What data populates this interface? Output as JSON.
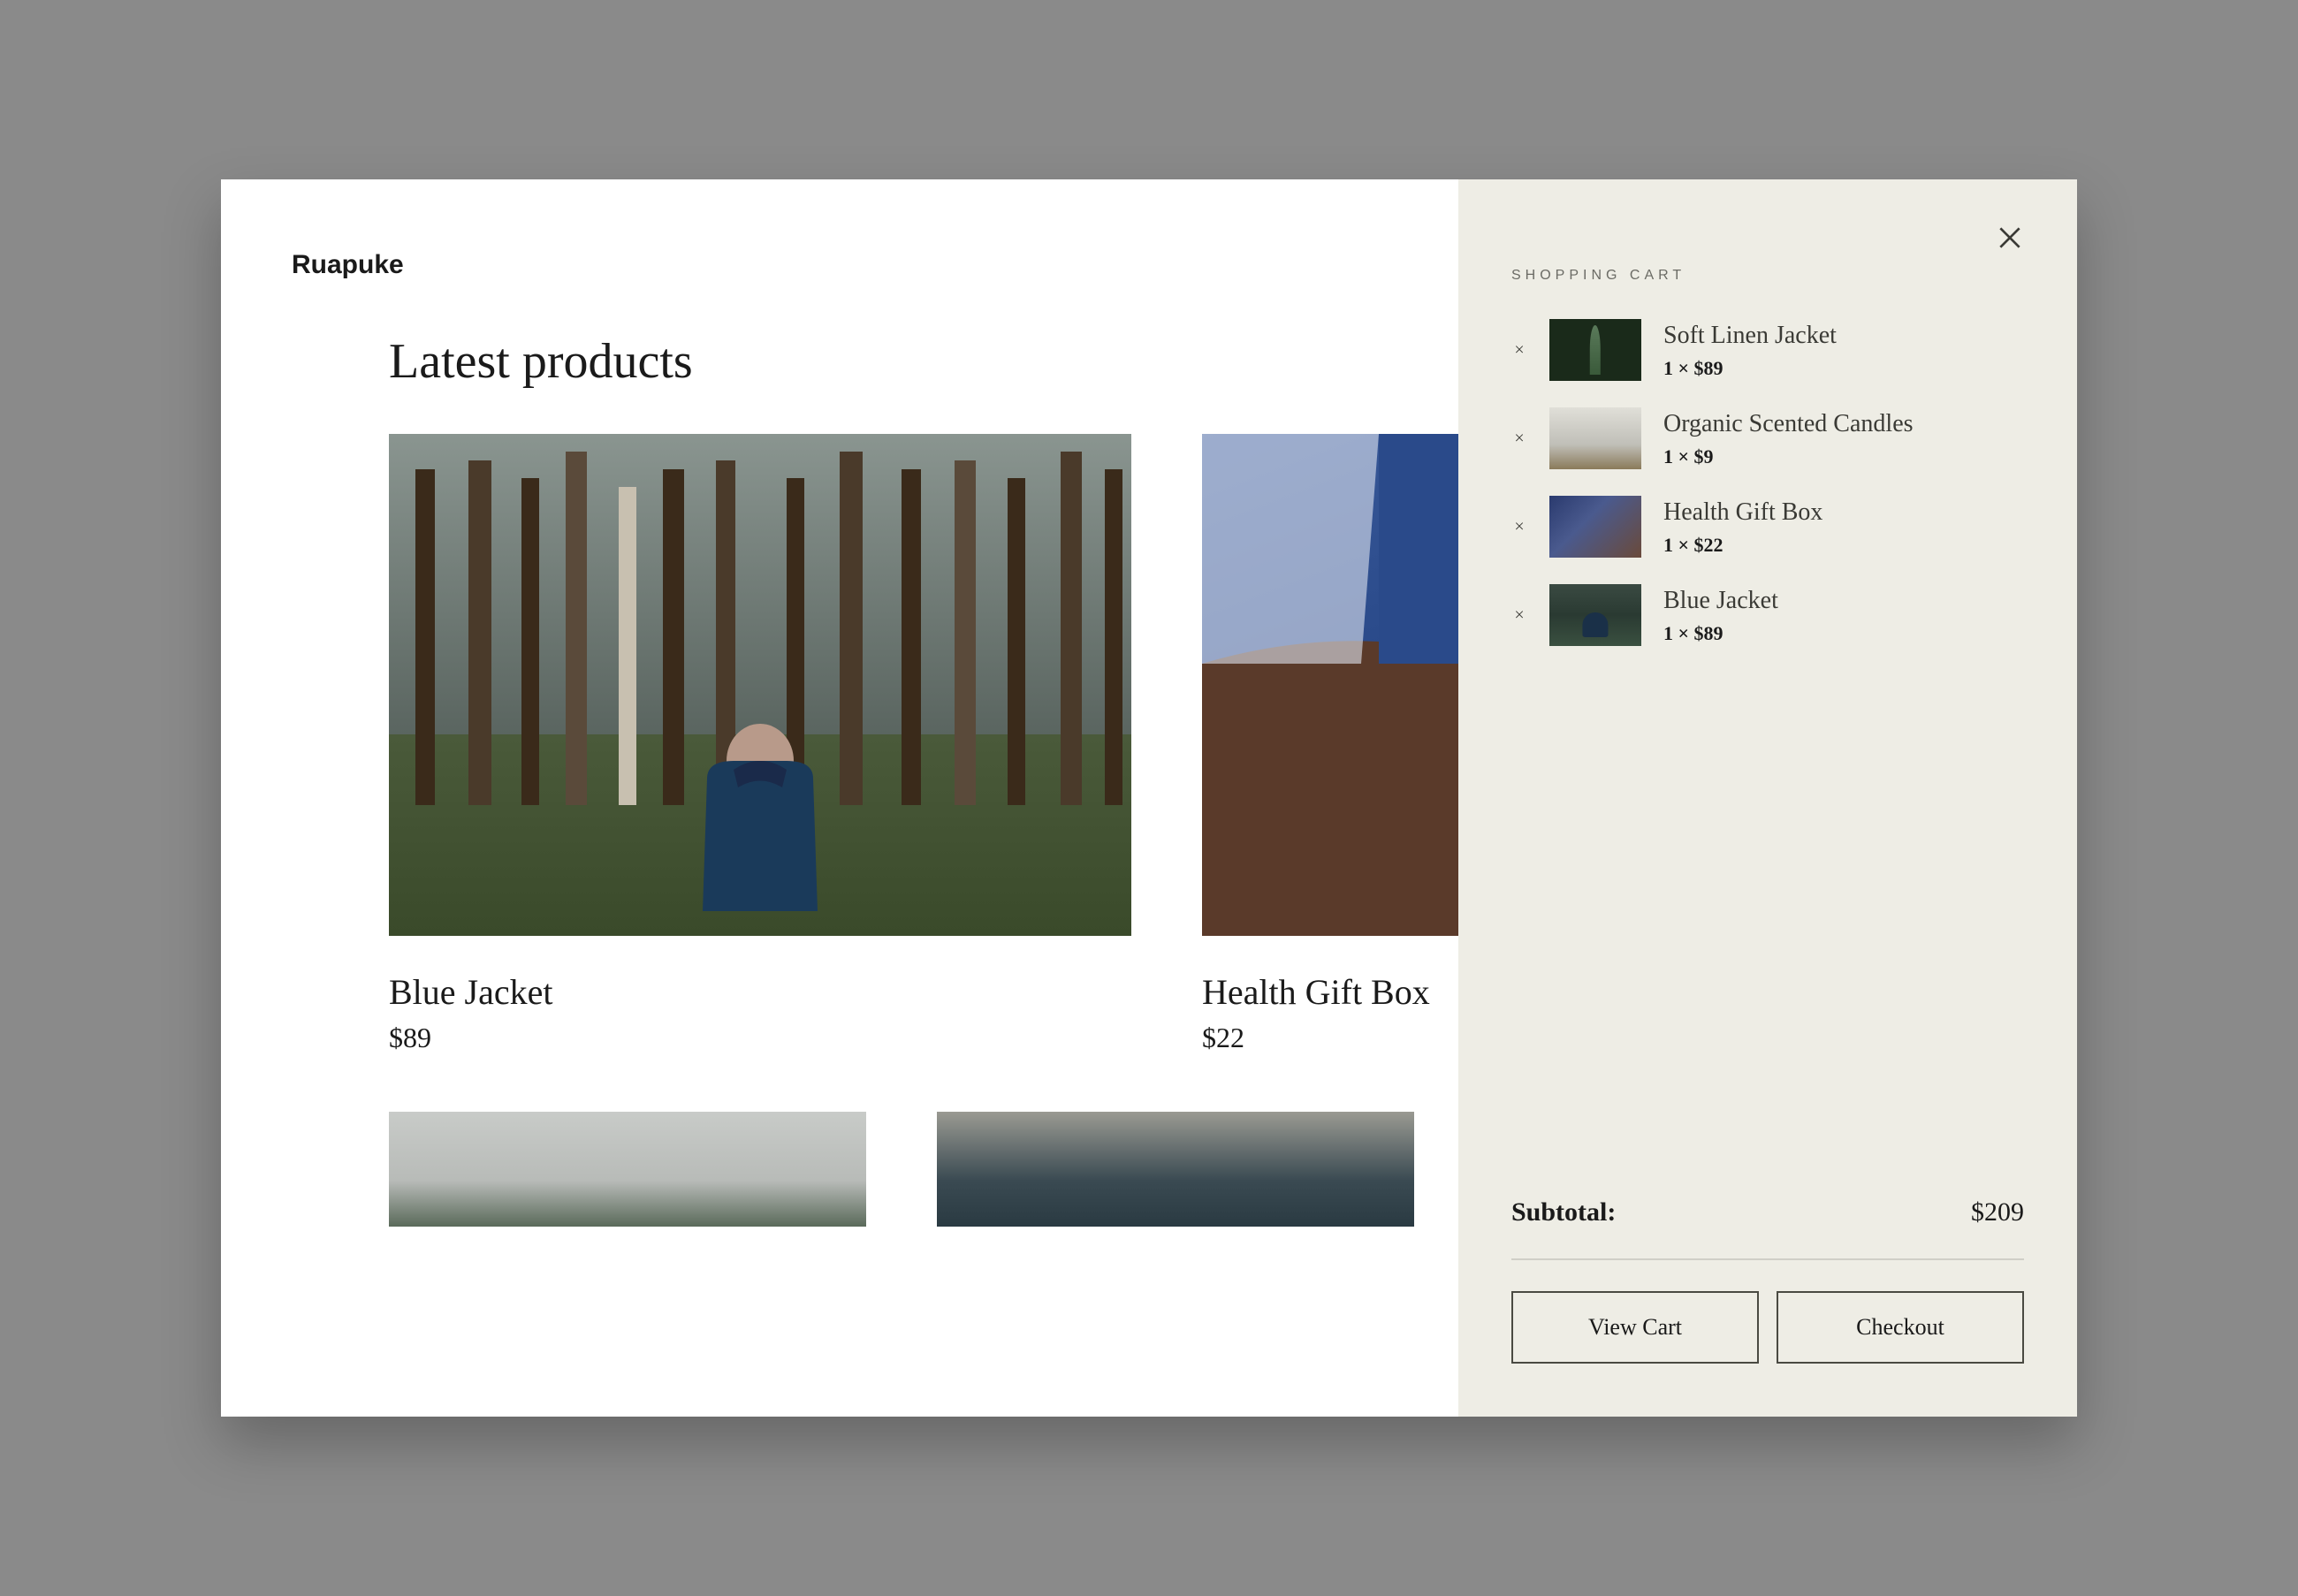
{
  "brand": "Ruapuke",
  "page_title": "Latest products",
  "products": [
    {
      "name": "Blue Jacket",
      "price": "$89"
    },
    {
      "name": "Health Gift Box",
      "price": "$22"
    }
  ],
  "cart": {
    "heading": "SHOPPING CART",
    "items": [
      {
        "name": "Soft Linen Jacket",
        "qty_price": "1 × $89"
      },
      {
        "name": "Organic Scented Candles",
        "qty_price": "1 × $9"
      },
      {
        "name": "Health Gift Box",
        "qty_price": "1 × $22"
      },
      {
        "name": "Blue Jacket",
        "qty_price": "1 × $89"
      }
    ],
    "subtotal_label": "Subtotal:",
    "subtotal_amount": "$209",
    "view_cart_label": "View Cart",
    "checkout_label": "Checkout",
    "remove_symbol": "×"
  }
}
